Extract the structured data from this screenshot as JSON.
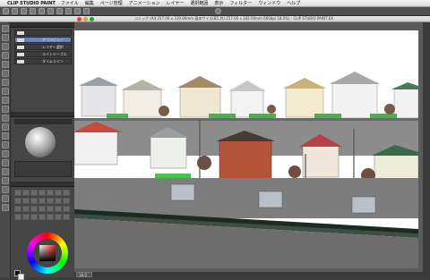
{
  "menubar": {
    "app_name": "CLIP STUDIO PAINT",
    "items": [
      "ファイル",
      "編集",
      "ページ管理",
      "アニメーション",
      "レイヤー",
      "選択範囲",
      "表示",
      "フィルター",
      "ウィンドウ",
      "ヘルプ"
    ]
  },
  "window": {
    "title": "コミック (A4 257.00 x 319.00mm 基本サイズ(B5 判) 257.00 x 182.00mm 600dpi 18.0%) - CLIP STUDIO PAINT EX"
  },
  "tool_icons": [
    "cursor-icon",
    "zoom-icon",
    "move-icon",
    "select-icon",
    "lasso-icon",
    "eyedropper-icon",
    "pen-icon",
    "pencil-icon",
    "brush-icon",
    "airbrush-icon",
    "decoration-icon",
    "eraser-icon",
    "blend-icon",
    "fill-icon",
    "gradient-icon",
    "figure-icon",
    "frame-icon",
    "ruler-icon",
    "text-icon",
    "balloon-icon",
    "correct-line-icon"
  ],
  "panels": {
    "layer_tab": "",
    "layers": [
      {
        "name": "",
        "selected": false
      },
      {
        "name": "ダブルビュー",
        "selected": true
      },
      {
        "name": "レイヤー選択",
        "selected": false
      },
      {
        "name": "ライトテーブル",
        "selected": false
      },
      {
        "name": "タイムライン",
        "selected": false
      }
    ],
    "brush_tab": ""
  },
  "status": {
    "zoom": "18.0"
  },
  "colors": {
    "accent": "#6a86b8",
    "window_bg": "#3c3c3c"
  }
}
